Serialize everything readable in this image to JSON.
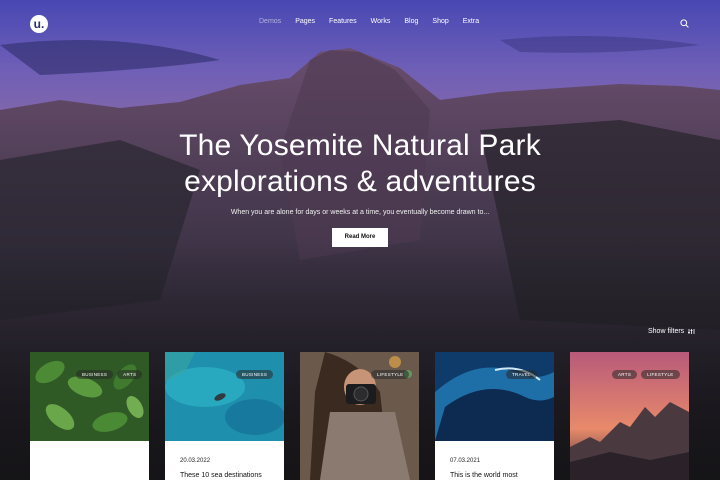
{
  "brand": {
    "logo_letter": "u."
  },
  "nav": {
    "items": [
      "Demos",
      "Pages",
      "Features",
      "Works",
      "Blog",
      "Shop",
      "Extra"
    ]
  },
  "hero": {
    "title_line1": "The Yosemite Natural Park",
    "title_line2": "explorations & adventures",
    "subtitle": "When you are alone for days or weeks at a time, you eventually become drawn to...",
    "button_label": "Read More"
  },
  "filters": {
    "label": "Show filters"
  },
  "cards": [
    {
      "tags": [
        "BUSINESS",
        "ARTS"
      ],
      "date": "",
      "title": ""
    },
    {
      "tags": [
        "BUSINESS"
      ],
      "date": "20.03.2022",
      "title": "These 10 sea destinations"
    },
    {
      "tags": [
        "LIFESTYLE"
      ],
      "date": "",
      "title": ""
    },
    {
      "tags": [
        "TRAVEL"
      ],
      "date": "07.03.2021",
      "title": "This is the world most"
    },
    {
      "tags": [
        "ARTS",
        "LIFESTYLE"
      ],
      "date": "",
      "title": ""
    }
  ],
  "colors": {
    "sky_top": "#4a4ab0",
    "sky_mid": "#7a5aa8",
    "rock": "#3a3040",
    "bg": "#151417"
  },
  "icons": {
    "search": "search-icon",
    "filter": "filter-icon"
  }
}
